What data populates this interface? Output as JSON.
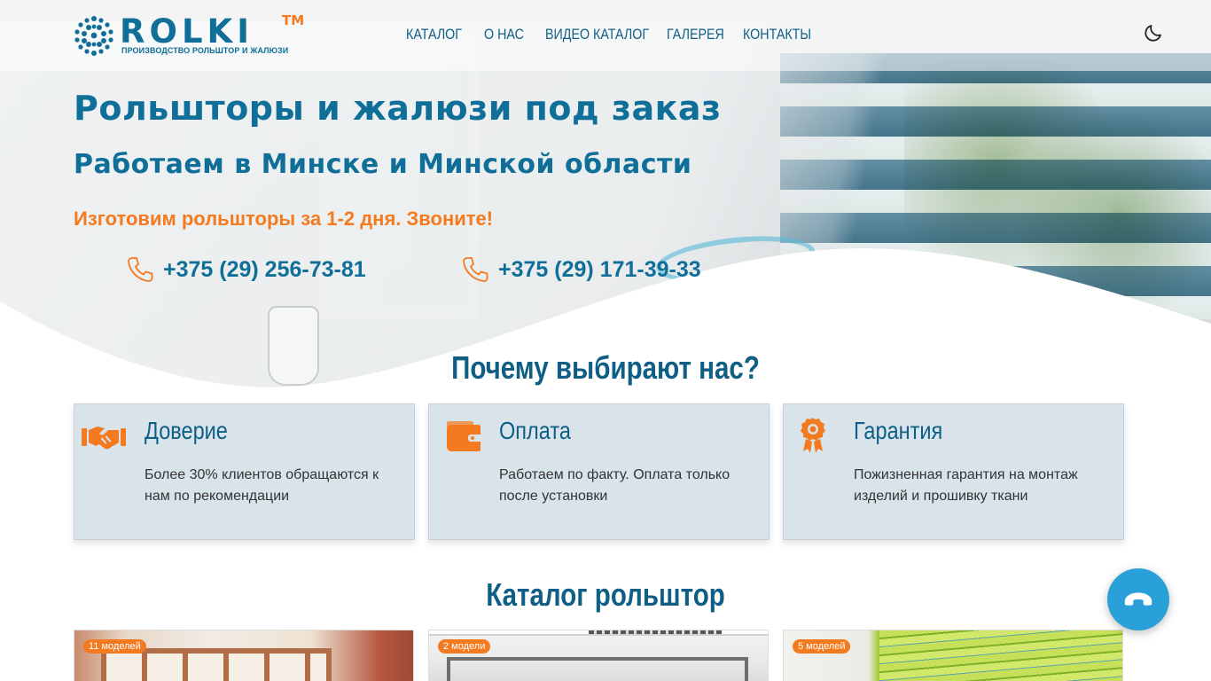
{
  "brand": {
    "name": "ROLKI",
    "tm": "TM",
    "tagline": "ПРОИЗВОДСТВО РОЛЬШТОР И ЖАЛЮЗИ",
    "primary_color": "#0f6f98",
    "accent_color": "#f47a1f"
  },
  "nav": {
    "items": [
      {
        "label": "КАТАЛОГ"
      },
      {
        "label": "О НАС"
      },
      {
        "label": "ВИДЕО КАТАЛОГ"
      },
      {
        "label": "ГАЛЕРЕЯ"
      },
      {
        "label": "КОНТАКТЫ"
      }
    ],
    "theme_toggle_icon": "moon-icon"
  },
  "hero": {
    "title": "Рольшторы и жалюзи под заказ",
    "subtitle": "Работаем в Минске и Минской области",
    "cta_text": "Изготовим рольшторы за 1-2 дня. Звоните!",
    "phones": [
      {
        "number": "+375 (29) 256-73-81",
        "icon": "phone-icon"
      },
      {
        "number": "+375 (29) 171-39-33",
        "icon": "phone-icon"
      }
    ]
  },
  "why_us": {
    "title": "Почему выбирают нас?",
    "cards": [
      {
        "title": "Доверие",
        "text": "Более 30% клиентов обращаются к нам по рекомендации",
        "icon": "handshake-icon"
      },
      {
        "title": "Оплата",
        "text": "Работаем по факту. Оплата только после установки",
        "icon": "wallet-icon"
      },
      {
        "title": "Гарантия",
        "text": "Пожизненная гарантия на монтаж изделий и прошивку ткани",
        "icon": "award-icon"
      }
    ]
  },
  "catalog": {
    "title": "Каталог рольштор",
    "items": [
      {
        "badge": "11 моделей"
      },
      {
        "badge": "2 модели"
      },
      {
        "badge": "5 моделей"
      }
    ]
  },
  "call_button": {
    "icon": "phone-hangup-icon",
    "color": "#2aa0d8"
  }
}
